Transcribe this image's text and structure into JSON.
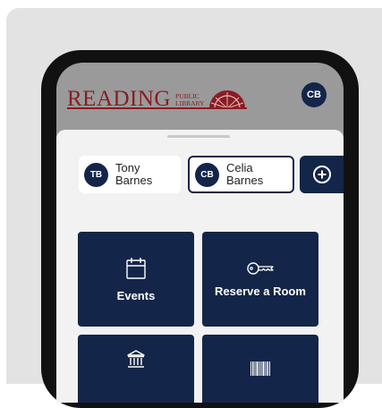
{
  "header": {
    "logo_word": "READING",
    "logo_public": "PUBLIC",
    "logo_library": "LIBRARY",
    "account_initials": "CB"
  },
  "accounts": [
    {
      "initials": "TB",
      "first": "Tony",
      "last": "Barnes",
      "selected": false
    },
    {
      "initials": "CB",
      "first": "Celia",
      "last": "Barnes",
      "selected": true
    }
  ],
  "tiles": [
    {
      "label": "Events",
      "icon": "calendar-icon"
    },
    {
      "label": "Reserve a Room",
      "icon": "key-icon"
    },
    {
      "label": "",
      "icon": "library-building-icon"
    },
    {
      "label": "",
      "icon": "barcode-icon"
    }
  ],
  "colors": {
    "navy": "#14254a",
    "brand_red": "#8a1c22",
    "background": "#e3e3e3"
  }
}
